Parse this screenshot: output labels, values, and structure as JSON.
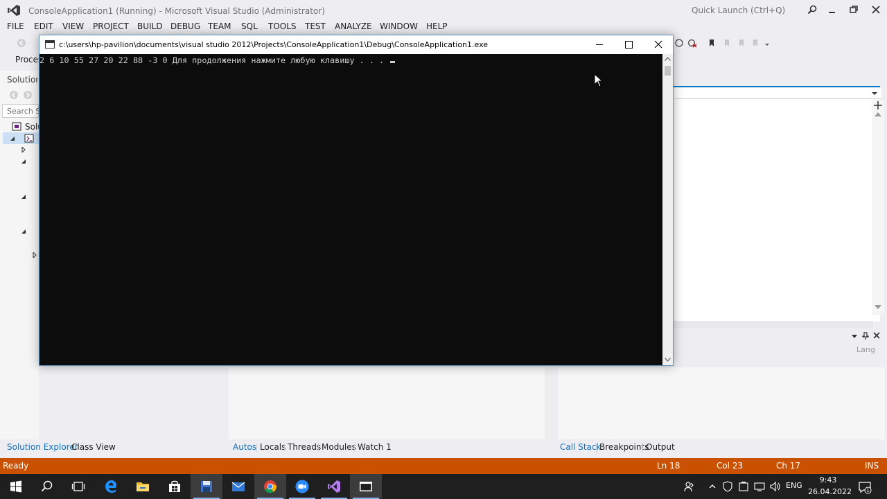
{
  "vs": {
    "title": "ConsoleApplication1 (Running) - Microsoft Visual Studio (Administrator)",
    "quick_launch_placeholder": "Quick Launch (Ctrl+Q)",
    "menu": [
      "FILE",
      "EDIT",
      "VIEW",
      "PROJECT",
      "BUILD",
      "DEBUG",
      "TEAM",
      "SQL",
      "TOOLS",
      "TEST",
      "ANALYZE",
      "WINDOW",
      "HELP"
    ],
    "process_label": "Proces",
    "solution_explorer": {
      "title": "Solution E",
      "search_placeholder": "Search So",
      "root_label": "Solu"
    },
    "right_panel_text": "Lang",
    "left_tabs": [
      "Solution Explorer",
      "Class View"
    ],
    "debug_tabs": [
      "Autos",
      "Locals",
      "Threads",
      "Modules",
      "Watch 1"
    ],
    "right_tabs": [
      "Call Stack",
      "Breakpoints",
      "Output"
    ],
    "status": {
      "ready": "Ready",
      "ln": "Ln 18",
      "col": "Col 23",
      "ch": "Ch 17",
      "ins": "INS"
    },
    "accent_color": "#007acc",
    "status_color": "#ca5100"
  },
  "console": {
    "title": "c:\\users\\hp-pavilion\\documents\\visual studio 2012\\Projects\\ConsoleApplication1\\Debug\\ConsoleApplication1.exe",
    "output": "2 6 10 55 27 20 22 88 -3 0 Для продолжения нажмите любую клавишу . . . "
  },
  "taskbar": {
    "apps": [
      "start-icon",
      "search-icon",
      "task-view-icon",
      "edge-icon",
      "file-explorer-icon",
      "store-icon",
      "save-icon",
      "mail-icon",
      "chrome-icon",
      "zoom-icon",
      "visual-studio-icon",
      "console-icon"
    ],
    "lang": "ENG",
    "time": "9:43",
    "date": "26.04.2022",
    "notification_count": "1"
  }
}
